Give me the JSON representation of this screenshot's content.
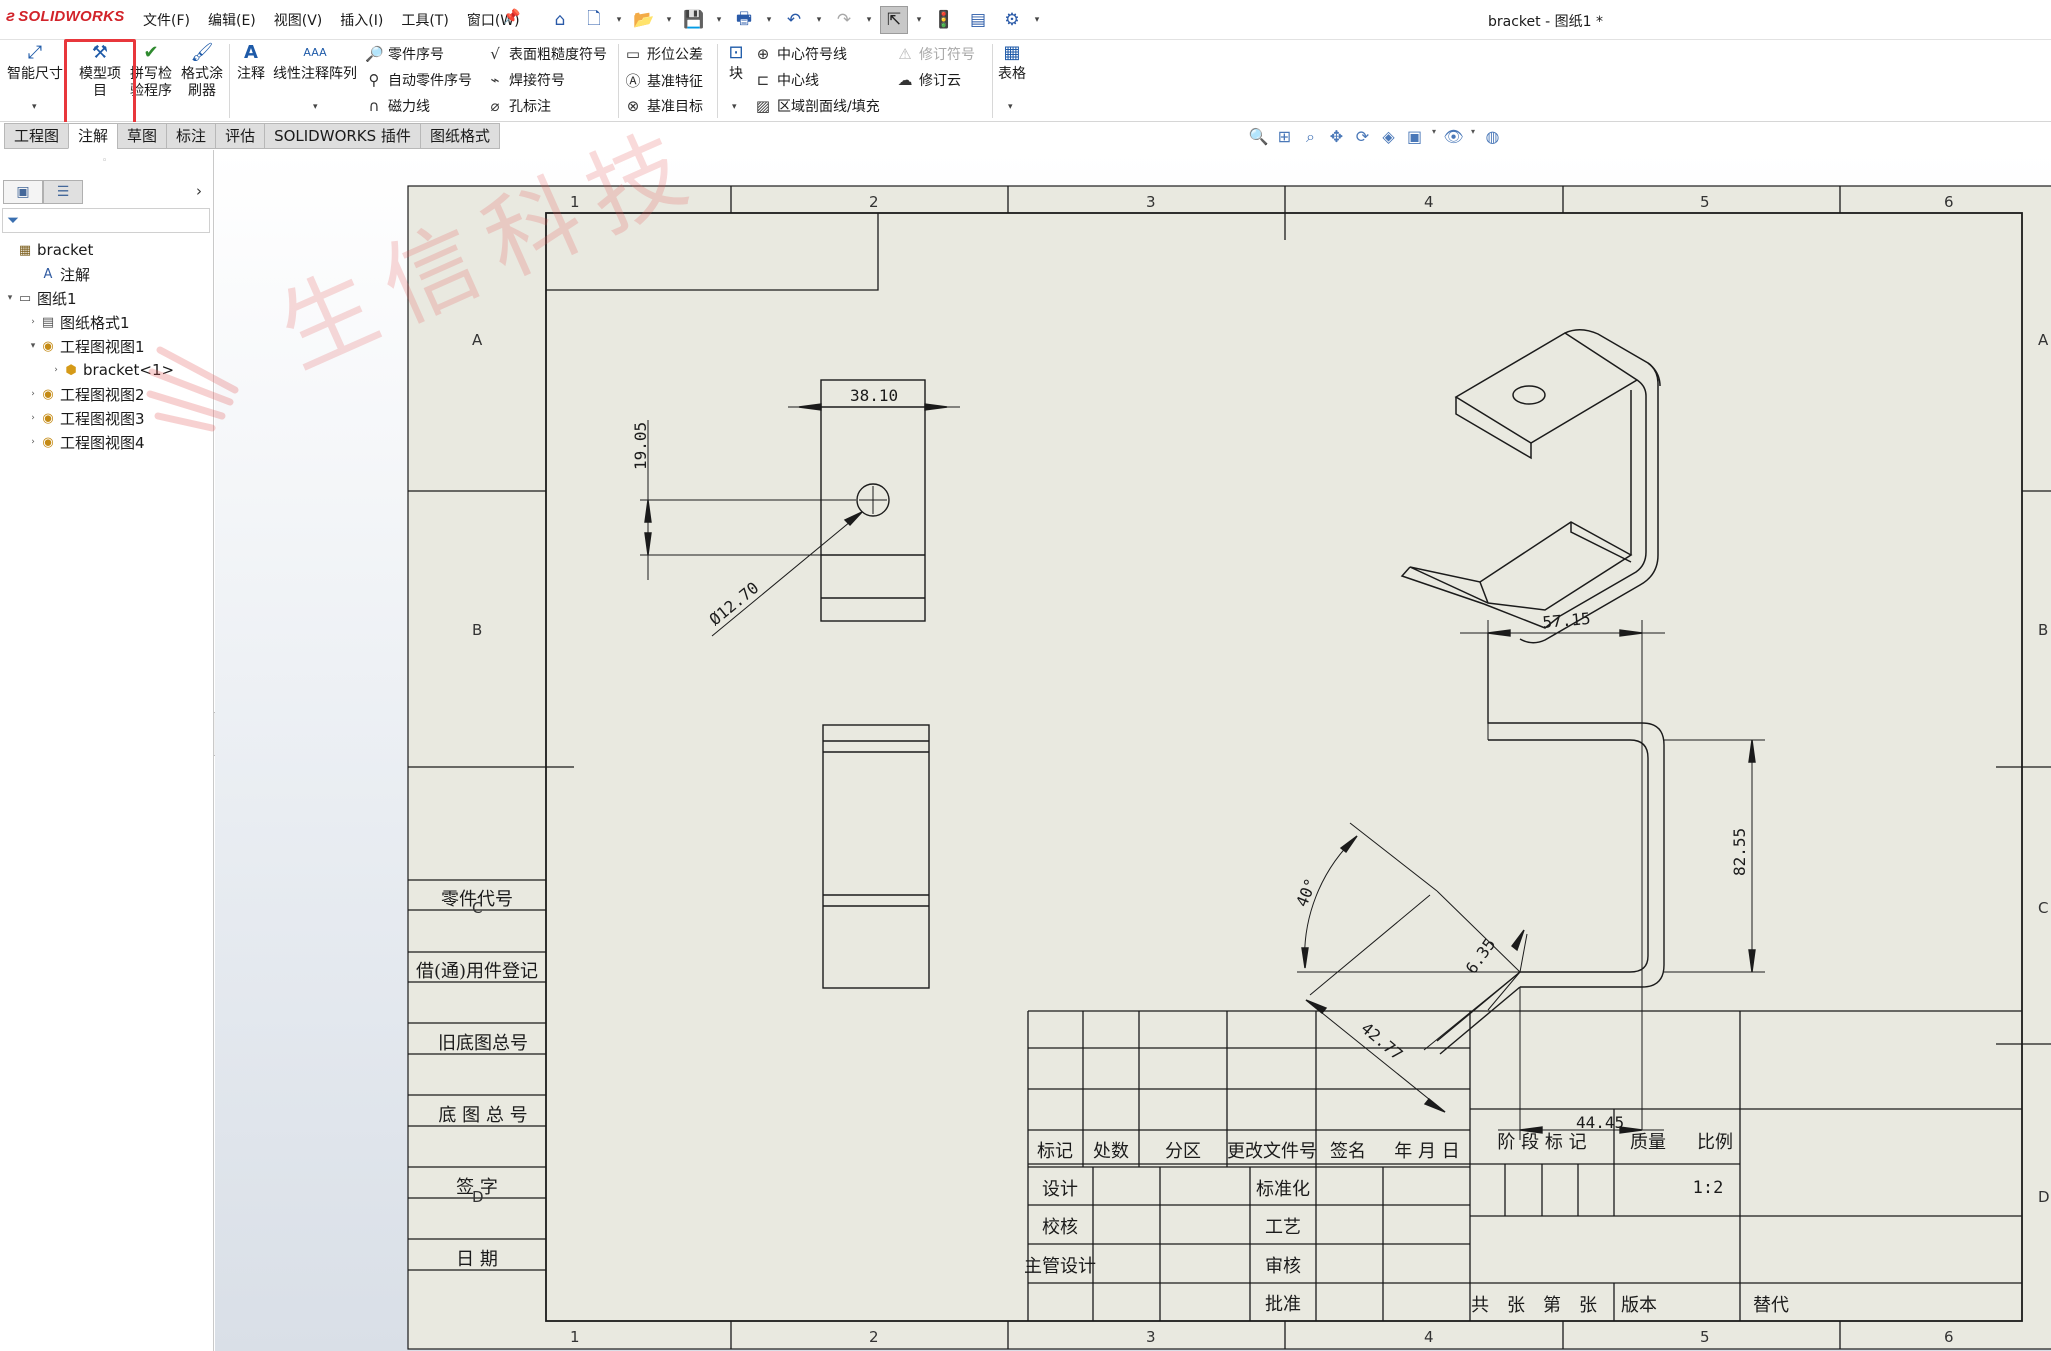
{
  "app": {
    "logo": "SOLIDWORKS",
    "doc_title": "bracket - 图纸1 *"
  },
  "menu": [
    "文件(F)",
    "编辑(E)",
    "视图(V)",
    "插入(I)",
    "工具(T)",
    "窗口(W)"
  ],
  "ribbon": {
    "smart_dim": "智能尺寸",
    "model_items": "模型项\n目",
    "spell_check": "拼写检\n验程序",
    "format_painter": "格式涂\n刷器",
    "note": "注释",
    "linear_note_pattern": "线性注释阵列",
    "balloon": "零件序号",
    "auto_balloon": "自动零件序号",
    "magnetic_line": "磁力线",
    "surface_finish": "表面粗糙度符号",
    "weld_symbol": "焊接符号",
    "hole_callout": "孔标注",
    "gtol": "形位公差",
    "datum_feature": "基准特征",
    "datum_target": "基准目标",
    "block": "块",
    "center_mark": "中心符号线",
    "centerline": "中心线",
    "area_hatch": "区域剖面线/填充",
    "revision_symbol": "修订符号",
    "revision_cloud": "修订云",
    "tables": "表格"
  },
  "tabs": [
    "工程图",
    "注解",
    "草图",
    "标注",
    "评估",
    "SOLIDWORKS 插件",
    "图纸格式"
  ],
  "selected_tab": "注解",
  "tree": [
    {
      "label": "bracket",
      "level": 0,
      "toggle": "",
      "icon": "drawing-icon"
    },
    {
      "label": "注解",
      "level": 1,
      "toggle": "",
      "icon": "annotations-icon"
    },
    {
      "label": "图纸1",
      "level": 0,
      "toggle": "▾",
      "icon": "sheet-icon"
    },
    {
      "label": "图纸格式1",
      "level": 1,
      "toggle": "›",
      "icon": "sheet-format-icon"
    },
    {
      "label": "工程图视图1",
      "level": 1,
      "toggle": "▾",
      "icon": "drawing-view-icon"
    },
    {
      "label": "bracket<1>",
      "level": 2,
      "toggle": "›",
      "icon": "part-icon"
    },
    {
      "label": "工程图视图2",
      "level": 1,
      "toggle": "›",
      "icon": "drawing-view-icon"
    },
    {
      "label": "工程图视图3",
      "level": 1,
      "toggle": "›",
      "icon": "drawing-view-icon"
    },
    {
      "label": "工程图视图4",
      "level": 1,
      "toggle": "›",
      "icon": "drawing-view-icon"
    }
  ],
  "sheet": {
    "zones_cols": [
      "1",
      "2",
      "3",
      "4",
      "5",
      "6"
    ],
    "zones_rows": [
      "A",
      "B",
      "C",
      "D"
    ],
    "left_block": [
      "零件代号",
      "借(通)用件登记",
      "旧底图总号",
      "底 图 总 号",
      "签 字",
      "日 期"
    ],
    "dims": {
      "d1": "38.10",
      "d2": "19.05",
      "d3": "Ø12.70",
      "d4": "57.15",
      "d5": "82.55",
      "d6": "40°",
      "d7": "6.35",
      "d8": "42.77",
      "d9": "44.45"
    },
    "title_block": {
      "hdr": [
        "标记",
        "处数",
        "分区",
        "更改文件号",
        "签名",
        "年 月 日"
      ],
      "stage": "阶 段 标 记",
      "mass": "质量",
      "scale_label": "比例",
      "scale_value": "1:2",
      "design": "设计",
      "standardize": "标准化",
      "check": "校核",
      "process": "工艺",
      "chief": "主管设计",
      "review": "审核",
      "approve": "批准",
      "total": "共　张　第　张",
      "version": "版本",
      "replace": "替代"
    }
  },
  "watermark": "生信科技",
  "colors": {
    "sheet_bg": "#e9e9e0",
    "accent_red": "#e8373c",
    "brand_red": "#d2232a"
  }
}
